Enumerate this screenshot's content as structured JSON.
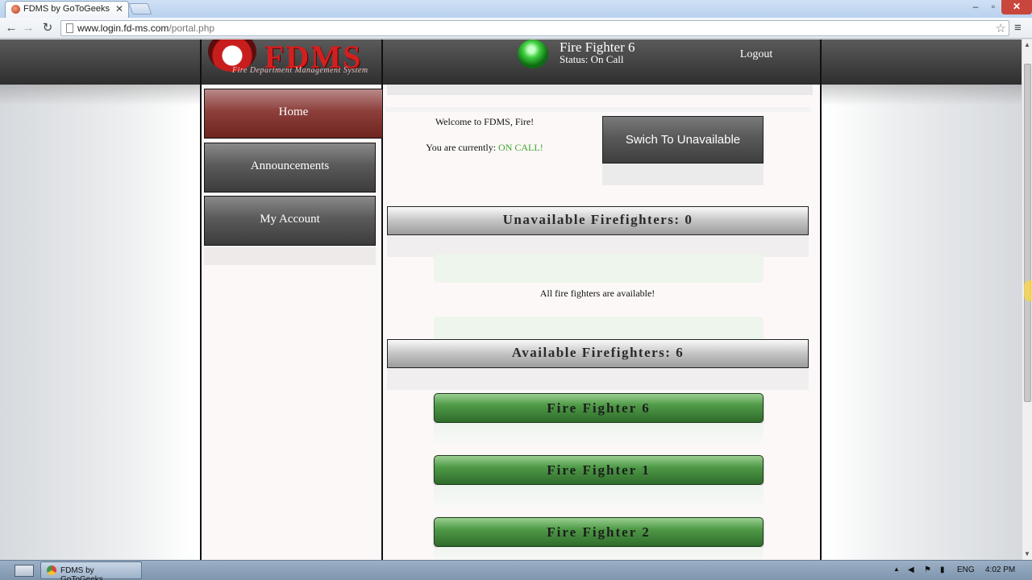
{
  "browser": {
    "tab_title": "FDMS by GoToGeeks",
    "tab_close": "✕",
    "url_domain": "www.login.fd-ms.com",
    "url_path": "/portal.php",
    "window_controls": {
      "minimize": "–",
      "maximize": "▫",
      "close": "✕"
    },
    "nav": {
      "back": "←",
      "forward": "→",
      "reload": "↻",
      "star": "☆",
      "menu": "≡"
    }
  },
  "header": {
    "logo_text": "FDMS",
    "logo_subtitle": "Fire Department Management System",
    "user_name": "Fire Fighter 6",
    "user_status": "Status: On Call",
    "logout_label": "Logout"
  },
  "sidebar": {
    "items": [
      {
        "label": "Home",
        "active": true
      },
      {
        "label": "Announcements",
        "active": false
      },
      {
        "label": "My Account",
        "active": false
      }
    ]
  },
  "main": {
    "welcome_text": "Welcome to FDMS, Fire!",
    "currently_prefix": "You are currently:",
    "currently_value": "ON CALL!",
    "switch_button_label": "Swich To Unavailable",
    "unavailable_header": "Unavailable Firefighters:  0",
    "unavailable_empty_message": "All fire fighters are available!",
    "available_header": "Available Firefighters:  6",
    "available_firefighters": [
      "Fire Fighter 6",
      "Fire Fighter 1",
      "Fire Fighter 2"
    ]
  },
  "taskbar": {
    "window_label": "FDMS by GoToGeeks...",
    "tray_arrow": "▲",
    "tray_volume": "◀",
    "tray_flag": "⚑",
    "tray_network": "▮",
    "language": "ENG",
    "clock": "4:02 PM"
  },
  "colors": {
    "on_call_green": "#3ba52c",
    "header_dark": "#2e2e2e",
    "home_red": "#8d3f3b",
    "firefighter_green": "#4f9a47",
    "logo_red": "#d41f1f"
  }
}
